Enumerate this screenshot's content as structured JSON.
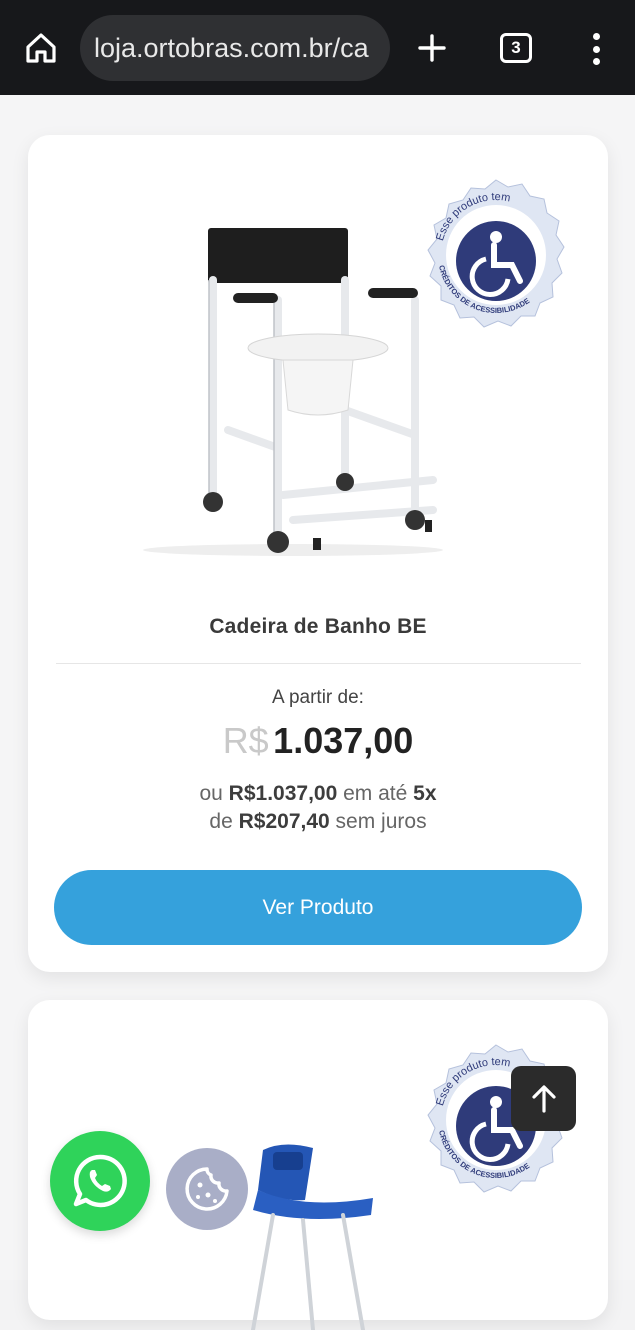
{
  "browser": {
    "url": "loja.ortobras.com.br/ca",
    "tab_count": "3"
  },
  "product": {
    "badge_text_top": "Esse produto tem",
    "badge_text_bottom": "CRÉDITOS DE ACESSIBILIDADE",
    "title": "Cadeira de Banho BE",
    "from_label": "A partir de:",
    "price_currency": "R$",
    "price_value": "1.037,00",
    "installment_prefix": "ou",
    "installment_total": "R$1.037,00",
    "installment_mid": "em até",
    "installment_count": "5x",
    "installment_of": "de",
    "installment_value": "R$207,40",
    "installment_suffix": "sem juros",
    "cta_label": "Ver Produto"
  },
  "product2": {
    "badge_text_top": "Esse produto tem",
    "badge_text_bottom": "CRÉDITOS DE ACESSIBILIDADE"
  },
  "colors": {
    "accent": "#35a1dc",
    "whatsapp": "#2fd35a",
    "badge_blue": "#2f3b7a"
  }
}
